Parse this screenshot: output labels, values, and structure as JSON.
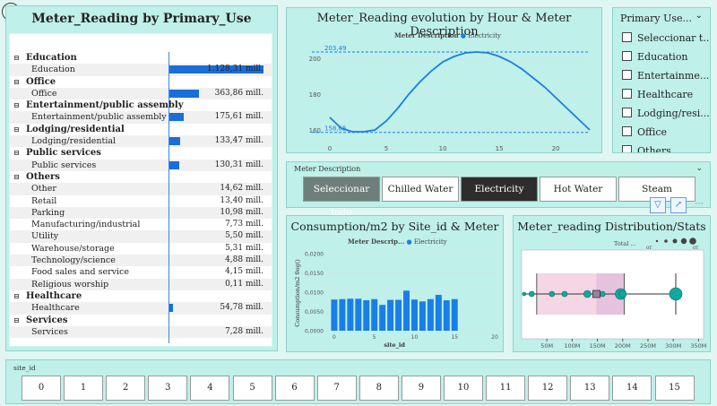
{
  "back_icon": "back-arrow-icon",
  "matrix": {
    "title": "Meter_Reading by Primary_Use",
    "rows": [
      {
        "type": "group",
        "label": "Education"
      },
      {
        "type": "child",
        "label": "Education",
        "value": "1.128,31 mill.",
        "frac": 1.0
      },
      {
        "type": "group",
        "label": "Office"
      },
      {
        "type": "child",
        "label": "Office",
        "value": "363,86 mill.",
        "frac": 0.322
      },
      {
        "type": "group",
        "label": "Entertainment/public assembly"
      },
      {
        "type": "child",
        "label": "Entertainment/public assembly",
        "value": "175,61 mill.",
        "frac": 0.156
      },
      {
        "type": "group",
        "label": "Lodging/residential"
      },
      {
        "type": "child",
        "label": "Lodging/residential",
        "value": "133,47 mill.",
        "frac": 0.118
      },
      {
        "type": "group",
        "label": "Public services"
      },
      {
        "type": "child",
        "label": "Public services",
        "value": "130,31 mill.",
        "frac": 0.115
      },
      {
        "type": "group",
        "label": "Others"
      },
      {
        "type": "child",
        "label": "Other",
        "value": "14,62 mill.",
        "frac": 0.013
      },
      {
        "type": "child",
        "label": "Retail",
        "value": "13,40 mill.",
        "frac": 0.012
      },
      {
        "type": "child",
        "label": "Parking",
        "value": "10,98 mill.",
        "frac": 0.01
      },
      {
        "type": "child",
        "label": "Manufacturing/industrial",
        "value": "7,73 mill.",
        "frac": 0.007
      },
      {
        "type": "child",
        "label": "Utility",
        "value": "5,50 mill.",
        "frac": 0.005
      },
      {
        "type": "child",
        "label": "Warehouse/storage",
        "value": "5,31 mill.",
        "frac": 0.005
      },
      {
        "type": "child",
        "label": "Technology/science",
        "value": "4,88 mill.",
        "frac": 0.004
      },
      {
        "type": "child",
        "label": "Food sales and service",
        "value": "4,15 mill.",
        "frac": 0.004
      },
      {
        "type": "child",
        "label": "Religious worship",
        "value": "0,11 mill.",
        "frac": 0.0001
      },
      {
        "type": "group",
        "label": "Healthcare"
      },
      {
        "type": "child",
        "label": "Healthcare",
        "value": "54,78 mill.",
        "frac": 0.049
      },
      {
        "type": "group",
        "label": "Services"
      },
      {
        "type": "child",
        "label": "Services",
        "value": "7,28 mill.",
        "frac": 0.006
      }
    ]
  },
  "line_chart": {
    "title": "Meter_Reading evolution by Hour & Meter Description",
    "legend_title": "Meter Description",
    "legend_item": "Electricity",
    "max_label": "203,49",
    "min_label": "158,65"
  },
  "primary_use_slicer": {
    "title": "Primary Use...",
    "items": [
      "Seleccionar t...",
      "Education",
      "Entertainme...",
      "Healthcare",
      "Lodging/resi...",
      "Office",
      "Others"
    ]
  },
  "meter_slicer": {
    "title": "Meter Description",
    "buttons": [
      "Seleccionar todo",
      "Chilled Water",
      "Electricity",
      "Hot Water",
      "Steam"
    ]
  },
  "toolbar": {
    "filter_icon": "filter-icon",
    "focus_icon": "focus-mode-icon",
    "more_icon": "more-options-icon"
  },
  "bar_chart": {
    "title": "Consumption/m2 by Site_id & Meter",
    "legend_title": "Meter Descrip...",
    "legend_item": "Electricity",
    "ylabel": "Consumption/m2 0og()",
    "xlabel": "site_id",
    "y_ticks": [
      "0,0000",
      "0,0050",
      "0,0100",
      "0,0150",
      "0,0200"
    ],
    "x_ticks": [
      "0",
      "5",
      "10",
      "15",
      "20"
    ]
  },
  "box_chart": {
    "title": "Meter_reading Distribution/Stats",
    "legend_title": "Total ...",
    "legend_low": "0T",
    "legend_high": "0T",
    "x_ticks": [
      "50M",
      "100M",
      "150M",
      "200M",
      "250M",
      "300M",
      "350M"
    ]
  },
  "site_slicer": {
    "title": "site_id",
    "buttons": [
      "0",
      "1",
      "2",
      "3",
      "4",
      "5",
      "6",
      "7",
      "8",
      "9",
      "10",
      "11",
      "12",
      "13",
      "14",
      "15"
    ]
  },
  "chart_data": [
    {
      "type": "bar",
      "title": "Meter_Reading by Primary_Use",
      "categories": [
        "Education",
        "Office",
        "Entertainment/public assembly",
        "Lodging/residential",
        "Public services",
        "Other",
        "Retail",
        "Parking",
        "Manufacturing/industrial",
        "Utility",
        "Warehouse/storage",
        "Technology/science",
        "Food sales and service",
        "Religious worship",
        "Healthcare",
        "Services"
      ],
      "values": [
        1128.31,
        363.86,
        175.61,
        133.47,
        130.31,
        14.62,
        13.4,
        10.98,
        7.73,
        5.5,
        5.31,
        4.88,
        4.15,
        0.11,
        54.78,
        7.28
      ],
      "unit": "mill."
    },
    {
      "type": "line",
      "title": "Meter_Reading evolution by Hour & Meter Description",
      "series": [
        {
          "name": "Electricity",
          "x": [
            0,
            1,
            2,
            3,
            4,
            5,
            6,
            7,
            8,
            9,
            10,
            11,
            12,
            13,
            14,
            15,
            16,
            17,
            18,
            19,
            20,
            21,
            22,
            23
          ],
          "values": [
            167,
            161,
            159,
            159,
            160,
            165,
            172,
            180,
            187,
            193,
            198,
            201,
            203,
            203.5,
            203,
            201,
            198,
            194,
            189,
            184,
            178,
            172,
            166,
            160
          ]
        }
      ],
      "x_ticks": [
        0,
        5,
        10,
        15,
        20
      ],
      "y_ticks": [
        160,
        180,
        200
      ],
      "xlim": [
        0,
        23
      ],
      "ylim": [
        155,
        208
      ],
      "reference_lines": [
        203.49,
        158.65
      ]
    },
    {
      "type": "bar",
      "title": "Consumption/m2 by Site_id & Meter",
      "series": [
        {
          "name": "Electricity",
          "x": [
            0,
            1,
            2,
            3,
            4,
            5,
            6,
            7,
            8,
            9,
            10,
            11,
            12,
            13,
            14,
            15
          ],
          "values": [
            0.0081,
            0.0082,
            0.0083,
            0.0083,
            0.0079,
            0.0082,
            0.0067,
            0.008,
            0.008,
            0.0104,
            0.0081,
            0.0076,
            0.0082,
            0.0093,
            0.0079,
            0.0082
          ]
        }
      ],
      "xlim": [
        -1,
        20
      ],
      "ylim": [
        0,
        0.02
      ]
    },
    {
      "type": "scatter",
      "title": "Meter_reading Distribution/Stats",
      "box": {
        "whisker_low": 5,
        "q1": 5,
        "median": 148,
        "q3": 203,
        "whisker_high": 305
      },
      "points_x": [
        5,
        20,
        60,
        85,
        130,
        160,
        196,
        200,
        305
      ],
      "xlim": [
        0,
        360
      ]
    }
  ]
}
